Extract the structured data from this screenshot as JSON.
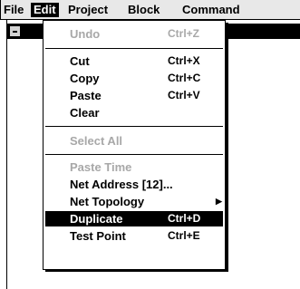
{
  "menubar": {
    "items": [
      {
        "label": "File"
      },
      {
        "label": "Edit"
      },
      {
        "label": "Project"
      },
      {
        "label": "Block"
      },
      {
        "label": "Command"
      }
    ]
  },
  "edit_menu": {
    "items": [
      {
        "label": "Undo",
        "shortcut": "Ctrl+Z",
        "enabled": false
      },
      {
        "label": "Cut",
        "shortcut": "Ctrl+X",
        "enabled": true
      },
      {
        "label": "Copy",
        "shortcut": "Ctrl+C",
        "enabled": true
      },
      {
        "label": "Paste",
        "shortcut": "Ctrl+V",
        "enabled": true
      },
      {
        "label": "Clear",
        "enabled": true
      },
      {
        "label": "Select All",
        "enabled": false
      },
      {
        "label": "Paste Time",
        "enabled": false
      },
      {
        "label": "Net Address [12]...",
        "enabled": true
      },
      {
        "label": "Net Topology",
        "enabled": true,
        "submenu": true
      },
      {
        "label": "Duplicate",
        "shortcut": "Ctrl+D",
        "enabled": true,
        "selected": true
      },
      {
        "label": "Test Point",
        "shortcut": "Ctrl+E",
        "enabled": true
      }
    ]
  },
  "icons": {
    "system_menu": "system-menu-dash-icon",
    "submenu": "submenu-arrow-icon"
  },
  "colors": {
    "menubar_bg": "#e8e8e8",
    "highlight": "#000000",
    "disabled_text": "#a8a8a8"
  }
}
